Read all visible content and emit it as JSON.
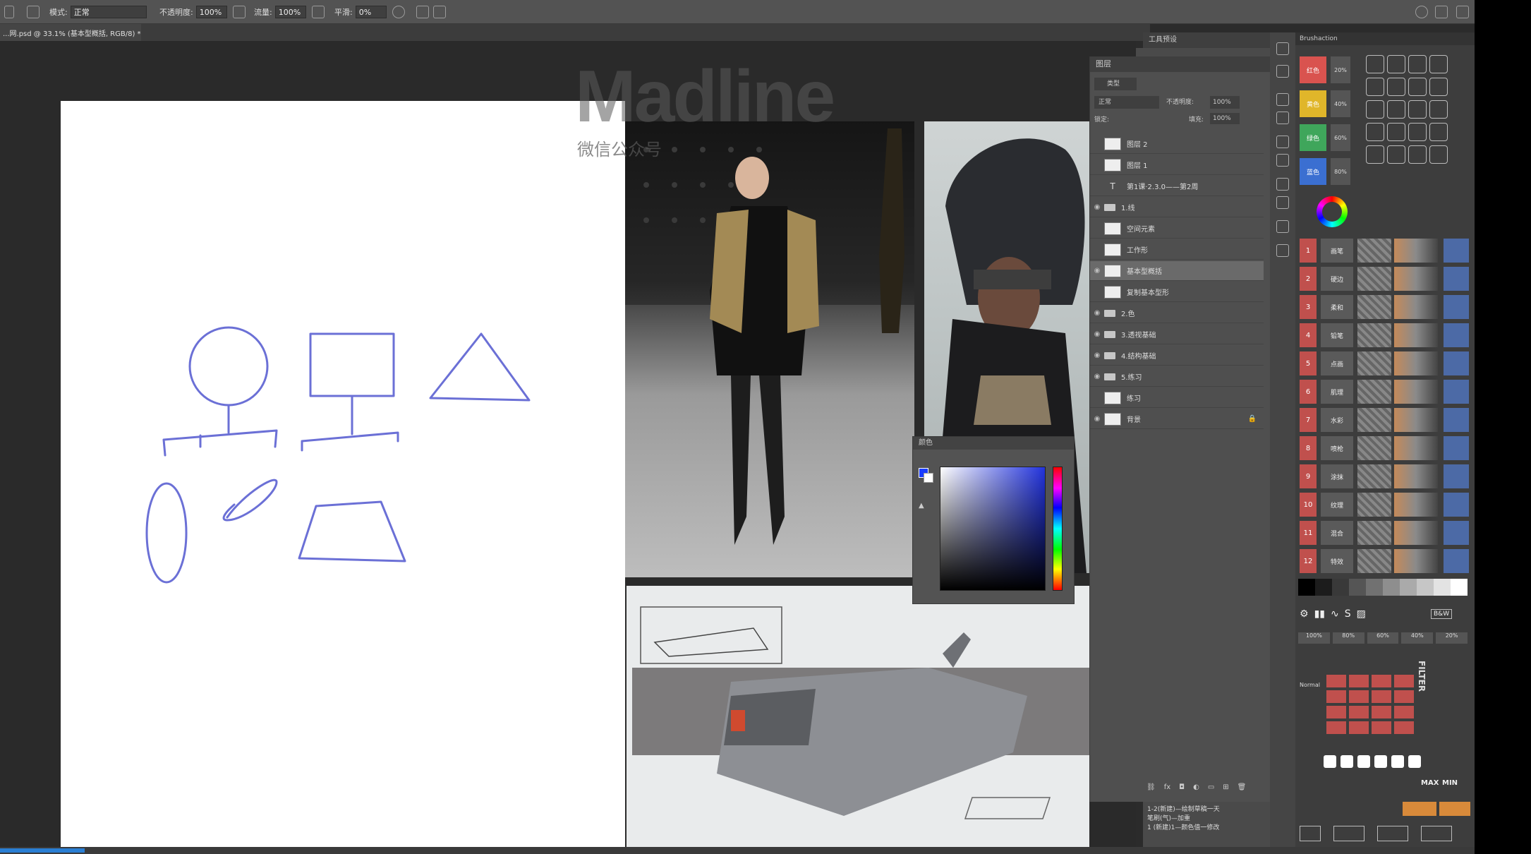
{
  "optionsbar": {
    "mode_label": "模式:",
    "mode_value": "正常",
    "opacity_label": "不透明度:",
    "opacity_value": "100%",
    "flow_label": "流量:",
    "flow_value": "100%",
    "smooth_label": "平滑:",
    "smooth_value": "0%"
  },
  "document": {
    "tab_title": "...网.psd @ 33.1% (基本型概括, RGB/8) *"
  },
  "watermark": {
    "logo_text": "Madline",
    "subtitle": "微信公众号"
  },
  "panels": {
    "toolpresets_title": "工具预设",
    "layers_title": "图层",
    "brushes_title": "Brushaction",
    "color_title": "颜色"
  },
  "layers_panel": {
    "search_placeholder": "类型",
    "blend_mode": "正常",
    "opacity_label": "不透明度:",
    "opacity_value": "100%",
    "lock_label": "锁定:",
    "fill_label": "填充:",
    "fill_value": "100%",
    "rows": [
      {
        "name": "图层 2",
        "kind": "layer",
        "visible": false
      },
      {
        "name": "图层 1",
        "kind": "layer",
        "visible": false
      },
      {
        "name": "第1课·2.3.0——第2周",
        "kind": "text",
        "visible": false
      },
      {
        "name": "1.线",
        "kind": "folder",
        "visible": true
      },
      {
        "name": "空间元素",
        "kind": "layer",
        "visible": false
      },
      {
        "name": "工作形",
        "kind": "layer",
        "visible": false
      },
      {
        "name": "基本型概括",
        "kind": "layer",
        "visible": true,
        "selected": true
      },
      {
        "name": "复制基本型形",
        "kind": "layer",
        "visible": false
      },
      {
        "name": "2.色",
        "kind": "folder",
        "visible": true
      },
      {
        "name": "3.透视基础",
        "kind": "folder",
        "visible": true
      },
      {
        "name": "4.结构基础",
        "kind": "folder",
        "visible": true
      },
      {
        "name": "5.练习",
        "kind": "folder",
        "visible": true
      },
      {
        "name": "练习",
        "kind": "layer",
        "visible": false
      },
      {
        "name": "背景",
        "kind": "layer",
        "visible": true,
        "locked": true
      }
    ]
  },
  "color_swatches": [
    {
      "label": "红色",
      "color": "#d9534f",
      "pct": "20%"
    },
    {
      "label": "黄色",
      "color": "#e0b62a",
      "pct": "40%"
    },
    {
      "label": "绿色",
      "color": "#3fa65b",
      "pct": "60%"
    },
    {
      "label": "蓝色",
      "color": "#3b6fd1",
      "pct": "80%"
    }
  ],
  "brush_rows": [
    {
      "n": "1",
      "name": "画笔"
    },
    {
      "n": "2",
      "name": "硬边"
    },
    {
      "n": "3",
      "name": "柔和"
    },
    {
      "n": "4",
      "name": "铅笔"
    },
    {
      "n": "5",
      "name": "点画"
    },
    {
      "n": "6",
      "name": "肌理"
    },
    {
      "n": "7",
      "name": "水彩"
    },
    {
      "n": "8",
      "name": "喷枪"
    },
    {
      "n": "9",
      "name": "涂抹"
    },
    {
      "n": "10",
      "name": "纹理"
    },
    {
      "n": "11",
      "name": "混合"
    },
    {
      "n": "12",
      "name": "特效"
    }
  ],
  "brushpanel_misc": {
    "filter_label": "FILTER",
    "normal_label": "Normal",
    "max_label": "MAX",
    "min_label": "MIN",
    "bw_label": "B&W",
    "pct_row": [
      "100%",
      "80%",
      "60%",
      "40%",
      "20%"
    ]
  },
  "history": [
    "1-2(新建)—绘制草稿一天",
    "笔刷(气)—加重",
    "1 (新建)1—颜色值一修改"
  ],
  "colors": {
    "ui_bg": "#535353",
    "canvas": "#ffffff",
    "sketch_stroke": "#6b70d6",
    "foreground": "#1a3cff"
  }
}
